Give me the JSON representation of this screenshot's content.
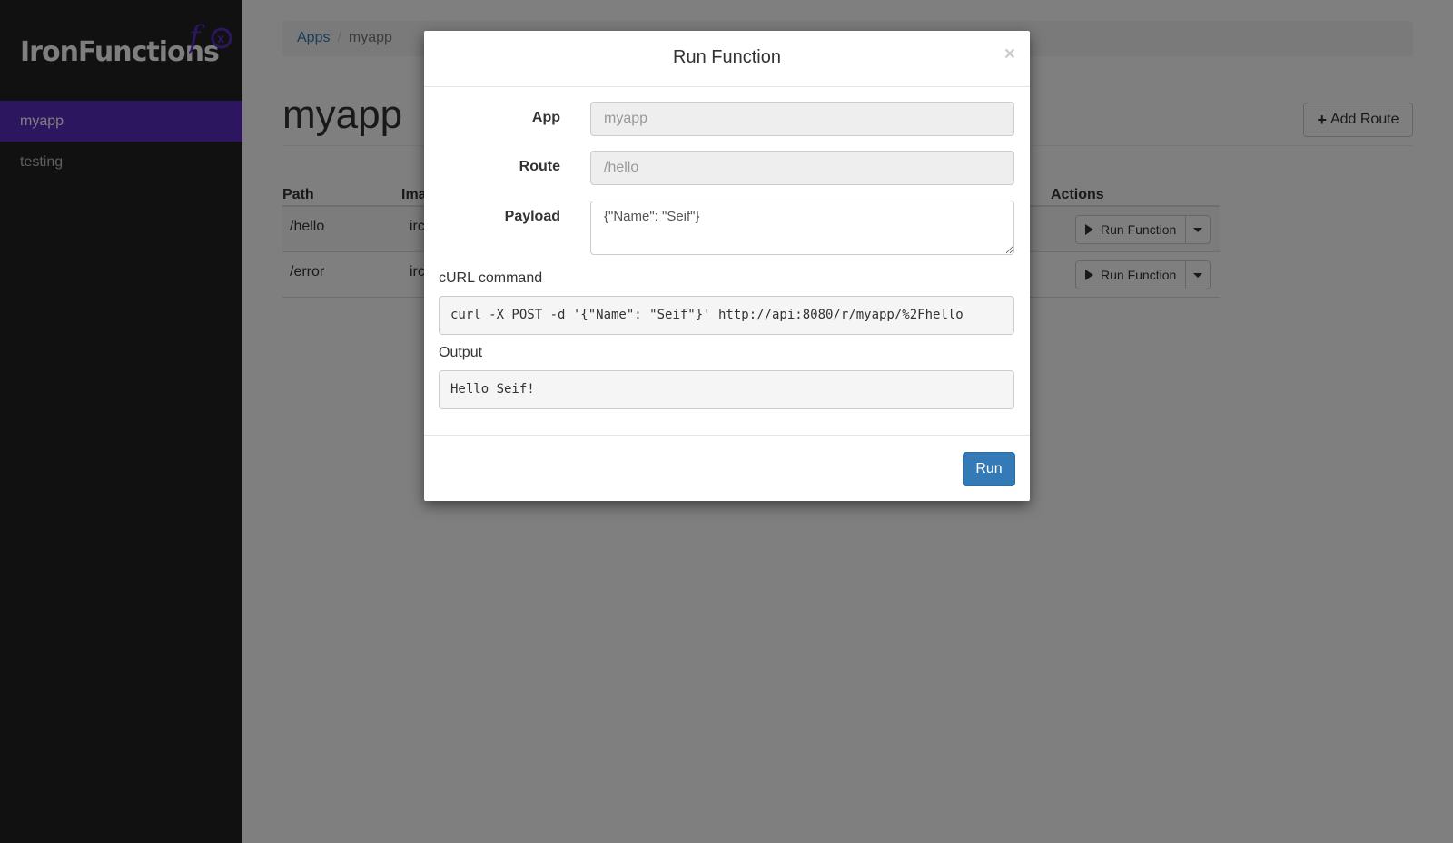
{
  "brand": {
    "name": "IronFunctions",
    "mark": "f(x)",
    "accent": "#5b2dc1"
  },
  "sidebar": {
    "items": [
      {
        "label": "myapp",
        "active": true
      },
      {
        "label": "testing",
        "active": false
      }
    ]
  },
  "breadcrumb": {
    "root": "Apps",
    "separator": "/",
    "current": "myapp"
  },
  "page": {
    "title": "myapp",
    "add_route_label": "Add Route"
  },
  "table": {
    "columns": {
      "path": "Path",
      "image": "Ima",
      "actions": "Actions"
    },
    "rows": [
      {
        "path": "/hello",
        "image": "irc",
        "action": "Run Function"
      },
      {
        "path": "/error",
        "image": "irc",
        "action": "Run Function"
      }
    ]
  },
  "modal": {
    "title": "Run Function",
    "close": "×",
    "app_label": "App",
    "app_value": "myapp",
    "route_label": "Route",
    "route_value": "/hello",
    "payload_label": "Payload",
    "payload_value": "{\"Name\": \"Seif\"}",
    "curl_label": "cURL command",
    "curl_value": "curl -X POST -d '{\"Name\": \"Seif\"}' http://api:8080/r/myapp/%2Fhello",
    "output_label": "Output",
    "output_value": "Hello Seif!",
    "run_label": "Run"
  }
}
